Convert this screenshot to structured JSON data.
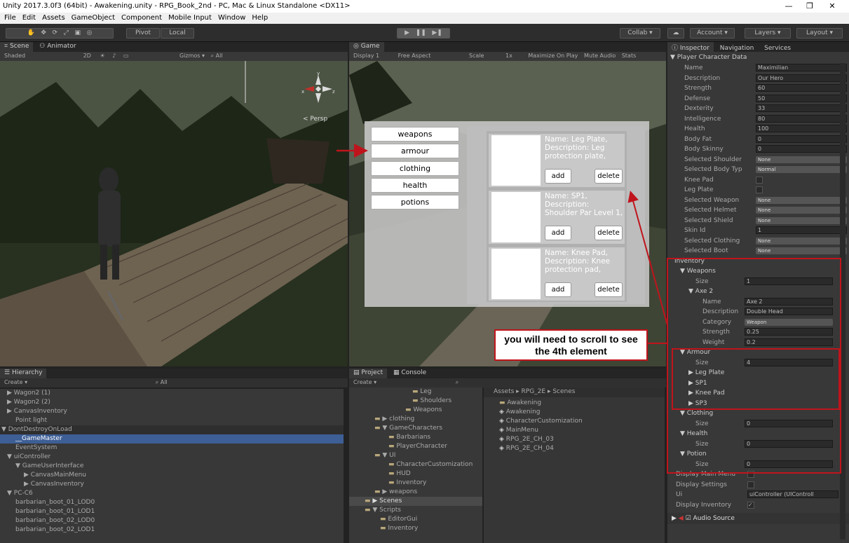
{
  "window": {
    "title": "Unity 2017.3.0f3 (64bit) - Awakening.unity - RPG_Book_2nd - PC, Mac & Linux Standalone <DX11>",
    "min": "—",
    "max": "❐",
    "close": "✕"
  },
  "menu": [
    "File",
    "Edit",
    "Assets",
    "GameObject",
    "Component",
    "Mobile Input",
    "Window",
    "Help"
  ],
  "toolbar": {
    "pivot": "Pivot",
    "local": "Local",
    "collab": "Collab ▾",
    "account": "Account ▾",
    "layers": "Layers ▾",
    "layout": "Layout ▾"
  },
  "scene": {
    "tab_scene": "Scene",
    "tab_animator": "Animator",
    "shaded": "Shaded",
    "mode2d": "2D",
    "gizmos": "Gizmos ▾",
    "search": "All",
    "persp": "Persp"
  },
  "game": {
    "tab": "Game",
    "display": "Display 1",
    "aspect": "Free Aspect",
    "scale_label": "Scale",
    "scale_val": "1x",
    "maximize": "Maximize On Play",
    "mute": "Mute Audio",
    "stats": "Stats"
  },
  "inventory_ui": {
    "categories": [
      "weapons",
      "armour",
      "clothing",
      "health",
      "potions"
    ],
    "items": [
      {
        "text": "Name: Leg Plate, Description: Leg protection plate,",
        "add": "add",
        "delete": "delete"
      },
      {
        "text": "Name: SP1, Description: Shoulder Par Level 1, Strength:",
        "add": "add",
        "delete": "delete"
      },
      {
        "text": "Name: Knee Pad, Description: Knee protection pad,",
        "add": "add",
        "delete": "delete"
      }
    ]
  },
  "callout": "you will need to scroll to see the 4th element",
  "hierarchy": {
    "tab": "Hierarchy",
    "create": "Create ▾",
    "search": "All",
    "rows": [
      {
        "t": "▶ Wagon2 (1)",
        "i": 10
      },
      {
        "t": "▶ Wagon2 (2)",
        "i": 10
      },
      {
        "t": "▶ CanvasInventory",
        "i": 10
      },
      {
        "t": "Point light",
        "i": 22
      },
      {
        "t": "▼ DontDestroyOnLoad",
        "i": 2,
        "sel": false,
        "hdr": true
      },
      {
        "t": "__GameMaster",
        "i": 22,
        "sel": true
      },
      {
        "t": "EventSystem",
        "i": 22
      },
      {
        "t": "▼ uiController",
        "i": 10
      },
      {
        "t": "▼ GameUserInterface",
        "i": 22
      },
      {
        "t": "▶ CanvasMainMenu",
        "i": 34
      },
      {
        "t": "▶ CanvasInventory",
        "i": 34
      },
      {
        "t": "▼ PC-C6",
        "i": 10
      },
      {
        "t": "barbarian_boot_01_LOD0",
        "i": 22
      },
      {
        "t": "barbarian_boot_01_LOD1",
        "i": 22
      },
      {
        "t": "barbarian_boot_02_LOD0",
        "i": 22
      },
      {
        "t": "barbarian_boot_02_LOD1",
        "i": 22
      }
    ]
  },
  "project": {
    "tab_project": "Project",
    "tab_console": "Console",
    "create": "Create ▾",
    "tree": [
      {
        "t": "Leg",
        "i": 90
      },
      {
        "t": "Shoulders",
        "i": 90
      },
      {
        "t": "Weapons",
        "i": 80
      },
      {
        "t": "▶ clothing",
        "i": 36
      },
      {
        "t": "▼ GameCharacters",
        "i": 36
      },
      {
        "t": "Barbarians",
        "i": 56
      },
      {
        "t": "PlayerCharacter",
        "i": 56
      },
      {
        "t": "▼ UI",
        "i": 36
      },
      {
        "t": "CharacterCustomization",
        "i": 56
      },
      {
        "t": "HUD",
        "i": 56
      },
      {
        "t": "Inventory",
        "i": 56
      },
      {
        "t": "▶ weapons",
        "i": 36
      },
      {
        "t": "▶ Scenes",
        "i": 22,
        "sel": true
      },
      {
        "t": "▼ Scripts",
        "i": 22
      },
      {
        "t": "EditorGui",
        "i": 44
      },
      {
        "t": "Inventory",
        "i": 44
      }
    ],
    "breadcrumb": "Assets ▸ RPG_2E ▸ Scenes",
    "files": [
      "Awakening",
      "Awakening",
      "CharacterCustomization",
      "MainMenu",
      "RPG_2E_CH_03",
      "RPG_2E_CH_04"
    ]
  },
  "inspector": {
    "tab_inspector": "Inspector",
    "tab_navigation": "Navigation",
    "tab_services": "Services",
    "header": "▼ Player Character Data",
    "rows": [
      {
        "l": "Name",
        "v": "Maximilian",
        "k": "f"
      },
      {
        "l": "Description",
        "v": "Our Hero",
        "k": "f"
      },
      {
        "l": "Strength",
        "v": "60",
        "k": "f"
      },
      {
        "l": "Defense",
        "v": "50",
        "k": "f"
      },
      {
        "l": "Dexterity",
        "v": "33",
        "k": "f"
      },
      {
        "l": "Intelligence",
        "v": "80",
        "k": "f"
      },
      {
        "l": "Health",
        "v": "100",
        "k": "f"
      },
      {
        "l": "Body Fat",
        "v": "0",
        "k": "f"
      },
      {
        "l": "Body Skinny",
        "v": "0",
        "k": "f"
      },
      {
        "l": "Selected Shoulder",
        "v": "None",
        "k": "d"
      },
      {
        "l": "Selected Body Typ",
        "v": "Normal",
        "k": "d"
      },
      {
        "l": "Knee Pad",
        "v": "",
        "k": "c"
      },
      {
        "l": "Leg Plate",
        "v": "",
        "k": "c"
      },
      {
        "l": "Selected Weapon",
        "v": "None",
        "k": "d"
      },
      {
        "l": "Selected Helmet",
        "v": "None",
        "k": "d"
      },
      {
        "l": "Selected Shield",
        "v": "None",
        "k": "d"
      },
      {
        "l": "Skin Id",
        "v": "1",
        "k": "f"
      },
      {
        "l": "Selected Clothing",
        "v": "None",
        "k": "d"
      },
      {
        "l": "Selected Boot",
        "v": "None",
        "k": "d"
      }
    ],
    "inv_rows": [
      {
        "l": "Inventory",
        "v": "",
        "k": "h",
        "i": 0
      },
      {
        "l": "▼ Weapons",
        "v": "",
        "k": "h",
        "i": 8
      },
      {
        "l": "Size",
        "v": "1",
        "k": "f",
        "i": 30
      },
      {
        "l": "▼ Axe 2",
        "v": "",
        "k": "h",
        "i": 20
      },
      {
        "l": "Name",
        "v": "Axe 2",
        "k": "f",
        "i": 40
      },
      {
        "l": "Description",
        "v": "Double Head",
        "k": "f",
        "i": 40
      },
      {
        "l": "Category",
        "v": "Weapon",
        "k": "d",
        "i": 40
      },
      {
        "l": "Strength",
        "v": "0.25",
        "k": "f",
        "i": 40
      },
      {
        "l": "Weight",
        "v": "0.2",
        "k": "f",
        "i": 40
      },
      {
        "l": "▼ Armour",
        "v": "",
        "k": "h",
        "i": 8
      },
      {
        "l": "Size",
        "v": "4",
        "k": "f",
        "i": 30
      },
      {
        "l": "▶ Leg Plate",
        "v": "",
        "k": "h",
        "i": 20
      },
      {
        "l": "▶ SP1",
        "v": "",
        "k": "h",
        "i": 20
      },
      {
        "l": "▶ Knee Pad",
        "v": "",
        "k": "h",
        "i": 20
      },
      {
        "l": "▶ SP3",
        "v": "",
        "k": "h",
        "i": 20
      },
      {
        "l": "▼ Clothing",
        "v": "",
        "k": "h",
        "i": 8
      },
      {
        "l": "Size",
        "v": "0",
        "k": "f",
        "i": 30
      },
      {
        "l": "▼ Health",
        "v": "",
        "k": "h",
        "i": 8
      },
      {
        "l": "Size",
        "v": "0",
        "k": "f",
        "i": 30
      },
      {
        "l": "▼ Potion",
        "v": "",
        "k": "h",
        "i": 8
      },
      {
        "l": "Size",
        "v": "0",
        "k": "f",
        "i": 30
      }
    ],
    "bottom_rows": [
      {
        "l": "Display Main Menu",
        "v": "",
        "k": "c"
      },
      {
        "l": "Display Settings",
        "v": "",
        "k": "c"
      },
      {
        "l": "Ui",
        "v": "uiController (UIControll",
        "k": "f"
      },
      {
        "l": "Display Inventory",
        "v": "✓",
        "k": "c"
      }
    ],
    "audio": "Audio Source"
  }
}
